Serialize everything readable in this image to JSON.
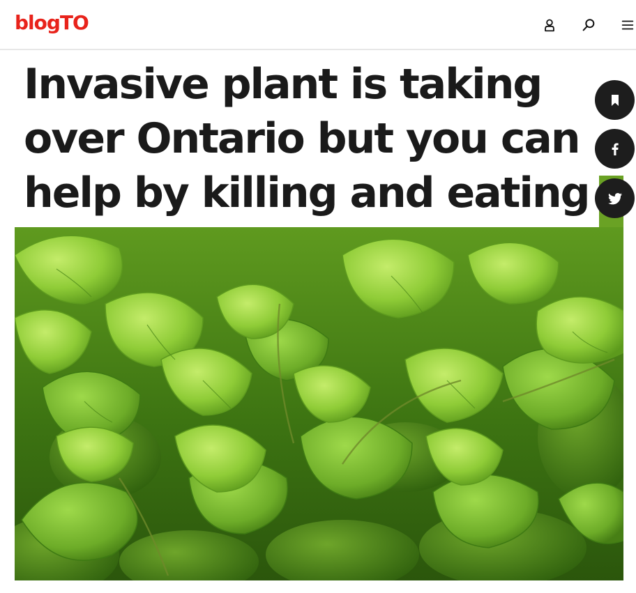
{
  "header": {
    "logo": "blogTO",
    "icons": [
      "user-icon",
      "search-icon",
      "menu-icon"
    ]
  },
  "article": {
    "title": "Invasive plant is taking over Ontario but you can help by killing and eating it"
  },
  "share": {
    "icons": [
      "bookmark-icon",
      "facebook-icon",
      "twitter-icon"
    ]
  },
  "colors": {
    "brand": "#e8231b",
    "text": "#1a1a1a",
    "share_bg": "#1d1d1d"
  }
}
